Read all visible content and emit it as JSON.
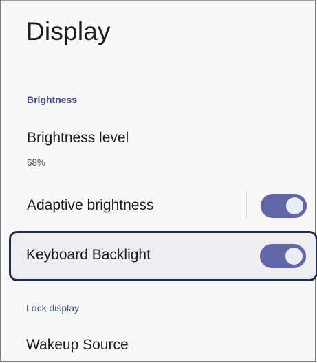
{
  "page": {
    "title": "Display"
  },
  "sections": {
    "brightness": "Brightness",
    "lock_display": "Lock display"
  },
  "brightness_level": {
    "label": "Brightness level",
    "value": "68%"
  },
  "adaptive_brightness": {
    "label": "Adaptive brightness",
    "enabled": true
  },
  "keyboard_backlight": {
    "label": "Keyboard Backlight",
    "enabled": true
  },
  "wakeup_source": {
    "label": "Wakeup Source"
  },
  "colors": {
    "accent": "#5f67a8",
    "section_header": "#3e4f8c",
    "highlight_border": "#1f2a4c"
  }
}
